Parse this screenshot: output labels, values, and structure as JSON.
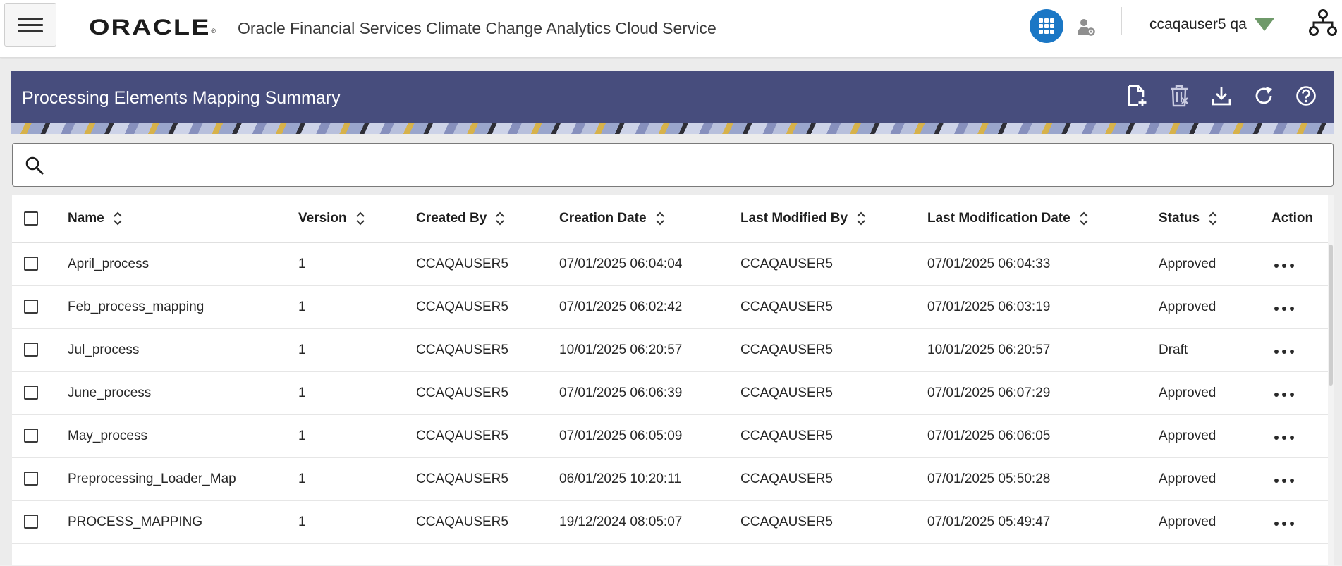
{
  "header": {
    "logo_text": "ORACLE",
    "logo_mark": "®",
    "app_title": "Oracle Financial Services Climate Change Analytics Cloud Service",
    "username": "ccaqauser5 qa"
  },
  "page": {
    "title": "Processing Elements Mapping Summary",
    "search_placeholder": ""
  },
  "table": {
    "columns": [
      "Name",
      "Version",
      "Created By",
      "Creation Date",
      "Last Modified By",
      "Last Modification Date",
      "Status",
      "Action"
    ],
    "rows": [
      {
        "name": "April_process",
        "version": "1",
        "created_by": "CCAQAUSER5",
        "creation_date": "07/01/2025 06:04:04",
        "last_modified_by": "CCAQAUSER5",
        "last_modification_date": "07/01/2025 06:04:33",
        "status": "Approved"
      },
      {
        "name": "Feb_process_mapping",
        "version": "1",
        "created_by": "CCAQAUSER5",
        "creation_date": "07/01/2025 06:02:42",
        "last_modified_by": "CCAQAUSER5",
        "last_modification_date": "07/01/2025 06:03:19",
        "status": "Approved"
      },
      {
        "name": "Jul_process",
        "version": "1",
        "created_by": "CCAQAUSER5",
        "creation_date": "10/01/2025 06:20:57",
        "last_modified_by": "CCAQAUSER5",
        "last_modification_date": "10/01/2025 06:20:57",
        "status": "Draft"
      },
      {
        "name": "June_process",
        "version": "1",
        "created_by": "CCAQAUSER5",
        "creation_date": "07/01/2025 06:06:39",
        "last_modified_by": "CCAQAUSER5",
        "last_modification_date": "07/01/2025 06:07:29",
        "status": "Approved"
      },
      {
        "name": "May_process",
        "version": "1",
        "created_by": "CCAQAUSER5",
        "creation_date": "07/01/2025 06:05:09",
        "last_modified_by": "CCAQAUSER5",
        "last_modification_date": "07/01/2025 06:06:05",
        "status": "Approved"
      },
      {
        "name": "Preprocessing_Loader_Map",
        "version": "1",
        "created_by": "CCAQAUSER5",
        "creation_date": "06/01/2025 10:20:11",
        "last_modified_by": "CCAQAUSER5",
        "last_modification_date": "07/01/2025 05:50:28",
        "status": "Approved"
      },
      {
        "name": "PROCESS_MAPPING",
        "version": "1",
        "created_by": "CCAQAUSER5",
        "creation_date": "19/12/2024 08:05:07",
        "last_modified_by": "CCAQAUSER5",
        "last_modification_date": "07/01/2025 05:49:47",
        "status": "Approved"
      }
    ]
  },
  "icons": {
    "menu": "hamburger-menu-icon",
    "apps": "grid-apps-icon",
    "user_settings": "user-settings-icon",
    "user_menu": "caret-down-icon",
    "hierarchy": "hierarchy-icon",
    "add": "add-document-icon",
    "delete": "delete-icon",
    "download": "download-icon",
    "refresh": "refresh-icon",
    "help": "help-icon",
    "search": "search-icon",
    "sort": "sort-icon",
    "actions": "more-actions-icon"
  },
  "colors": {
    "header_band": "#474d7d",
    "apps_button": "#1b77c5",
    "caret": "#5f8f5f"
  }
}
